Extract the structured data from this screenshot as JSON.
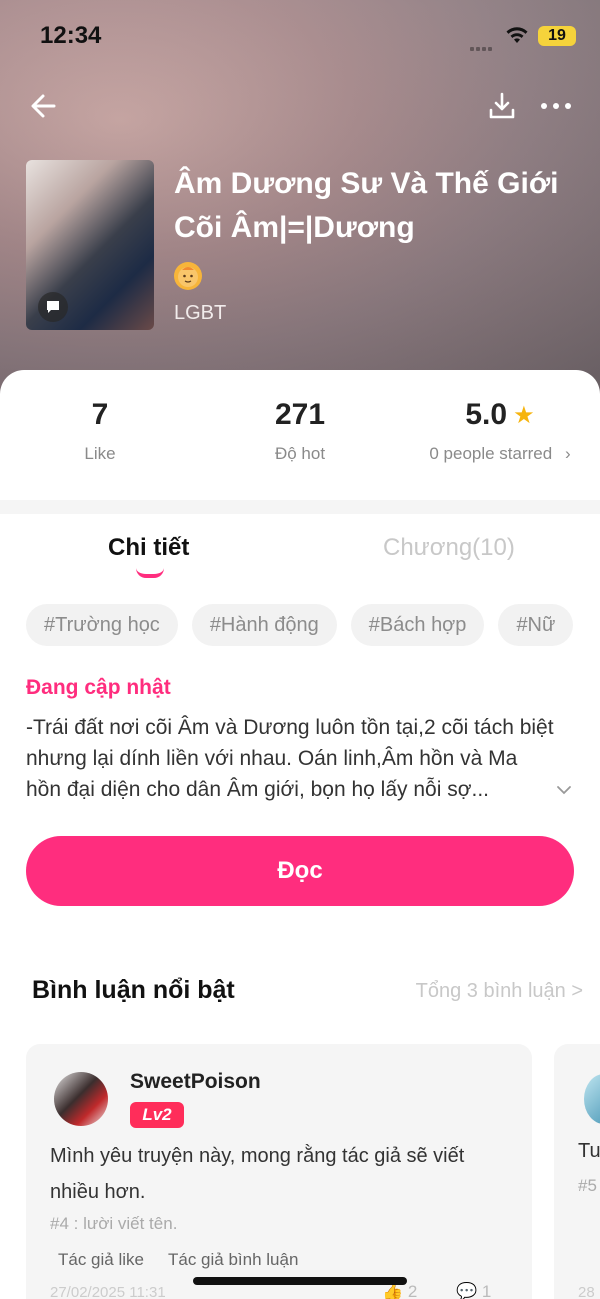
{
  "status_bar": {
    "time": "12:34",
    "battery": "19",
    "icons": [
      "signal-icon",
      "wifi-icon",
      "battery-icon"
    ]
  },
  "nav": {
    "icons": [
      "back-arrow-icon",
      "download-icon",
      "more-icon"
    ]
  },
  "story": {
    "title": "Âm Dương Sư Và Thế Giới Cõi Âm|=|Dương",
    "genre": "LGBT",
    "cover_badge_icon": "chat-bubble-icon"
  },
  "stats": {
    "likes": {
      "value": "7",
      "label": "Like"
    },
    "hot": {
      "value": "271",
      "label": "Độ hot"
    },
    "rating": {
      "value": "5.0",
      "label": "0 people starred",
      "chevron": "›"
    }
  },
  "tabs": [
    {
      "label": "Chi tiết",
      "active": true
    },
    {
      "label": "Chương(10)",
      "active": false
    }
  ],
  "tags": [
    "#Trường học",
    "#Hành động",
    "#Bách hợp",
    "#Nữ"
  ],
  "status_text": "Đang cập nhật",
  "description": "-Trái đất nơi cõi Âm và Dương luôn tồn tại,2 cõi tách biệt nhưng lại dính liền với nhau. Oán linh,Âm hồn và Ma hồn đại diện cho dân Âm giới, bọn họ lấy nỗi sợ...",
  "read_button": "Đọc",
  "comments": {
    "title": "Bình luận nổi bật",
    "total": "Tổng 3 bình luận >",
    "items": [
      {
        "user": "SweetPoison",
        "level": "Lv2",
        "text": "Mình yêu truyện này, mong rằng tác giả sẽ viết nhiều hơn.",
        "chapter": "#4 : lười viết tên.",
        "action_author_like": "Tác giả like",
        "action_author_reply": "Tác giả bình luận",
        "date": "27/02/2025 11:31",
        "likes": "2",
        "replies": "1"
      },
      {
        "text": "Tu",
        "chapter": "#5",
        "date": "28"
      }
    ]
  },
  "colors": {
    "accent": "#ff2d7e",
    "star": "#f6b40e",
    "level_badge": "#ff2d5a"
  }
}
